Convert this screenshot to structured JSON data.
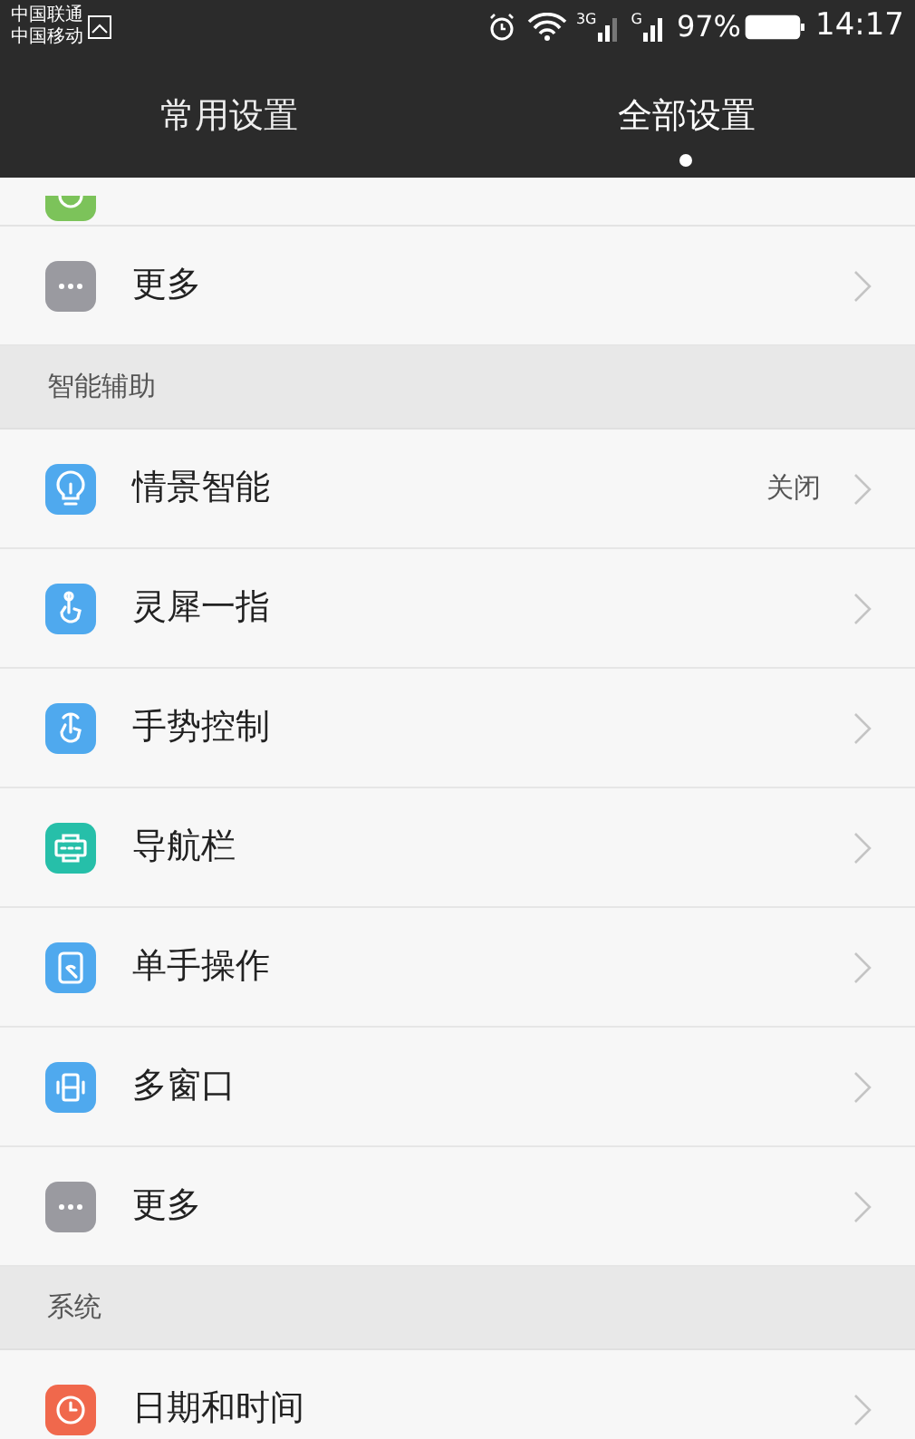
{
  "status_bar": {
    "carriers": [
      "中国联通",
      "中国移动"
    ],
    "network_labels": [
      "3G",
      "G"
    ],
    "battery": "97%",
    "time": "14:17"
  },
  "tabs": [
    {
      "label": "常用设置",
      "selected": false
    },
    {
      "label": "全部设置",
      "selected": true
    }
  ],
  "sections": [
    {
      "items": [
        {
          "kind": "partial"
        },
        {
          "kind": "more",
          "label": "更多"
        }
      ]
    },
    {
      "title": "智能辅助",
      "items": [
        {
          "kind": "bulb",
          "label": "情景智能",
          "value": "关闭"
        },
        {
          "kind": "finger",
          "label": "灵犀一指"
        },
        {
          "kind": "gesture",
          "label": "手势控制"
        },
        {
          "kind": "nav",
          "label": "导航栏"
        },
        {
          "kind": "onehand",
          "label": "单手操作"
        },
        {
          "kind": "multiwindow",
          "label": "多窗口"
        },
        {
          "kind": "more",
          "label": "更多"
        }
      ]
    },
    {
      "title": "系统",
      "items": [
        {
          "kind": "clock",
          "label": "日期和时间"
        }
      ]
    }
  ]
}
